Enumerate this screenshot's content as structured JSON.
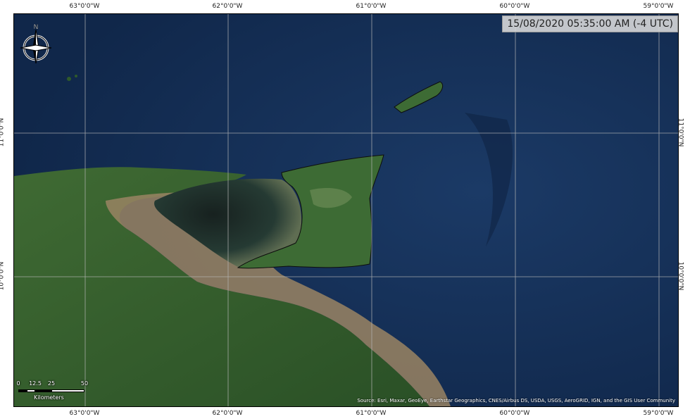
{
  "map": {
    "timestamp": "15/08/2020 05:35:00 AM (-4 UTC)",
    "attribution": "Source: Esri, Maxar, GeoEye, Earthstar Geographics, CNES/Airbus DS, USDA, USGS, AeroGRID, IGN, and the GIS User Community",
    "north_label": "N",
    "longitude_ticks": [
      "63°0'0\"W",
      "62°0'0\"W",
      "61°0'0\"W",
      "60°0'0\"W",
      "59°0'0\"W"
    ],
    "latitude_ticks": [
      "11°0'0\"N",
      "10°0'0\"N"
    ],
    "scalebar": {
      "labels": [
        "0",
        "12.5",
        "25",
        "50"
      ],
      "unit": "Kilometers"
    },
    "colors": {
      "ocean": "#163057",
      "deep_ocean": "#12284a",
      "land": "#2f5a2a",
      "land_light": "#4f7a3c",
      "sediment": "#9a8463",
      "gulf_dark": "#1a2b2a",
      "grid": "#b8b8b8"
    },
    "icons": {
      "north_arrow": "north-arrow-compass-icon"
    }
  }
}
